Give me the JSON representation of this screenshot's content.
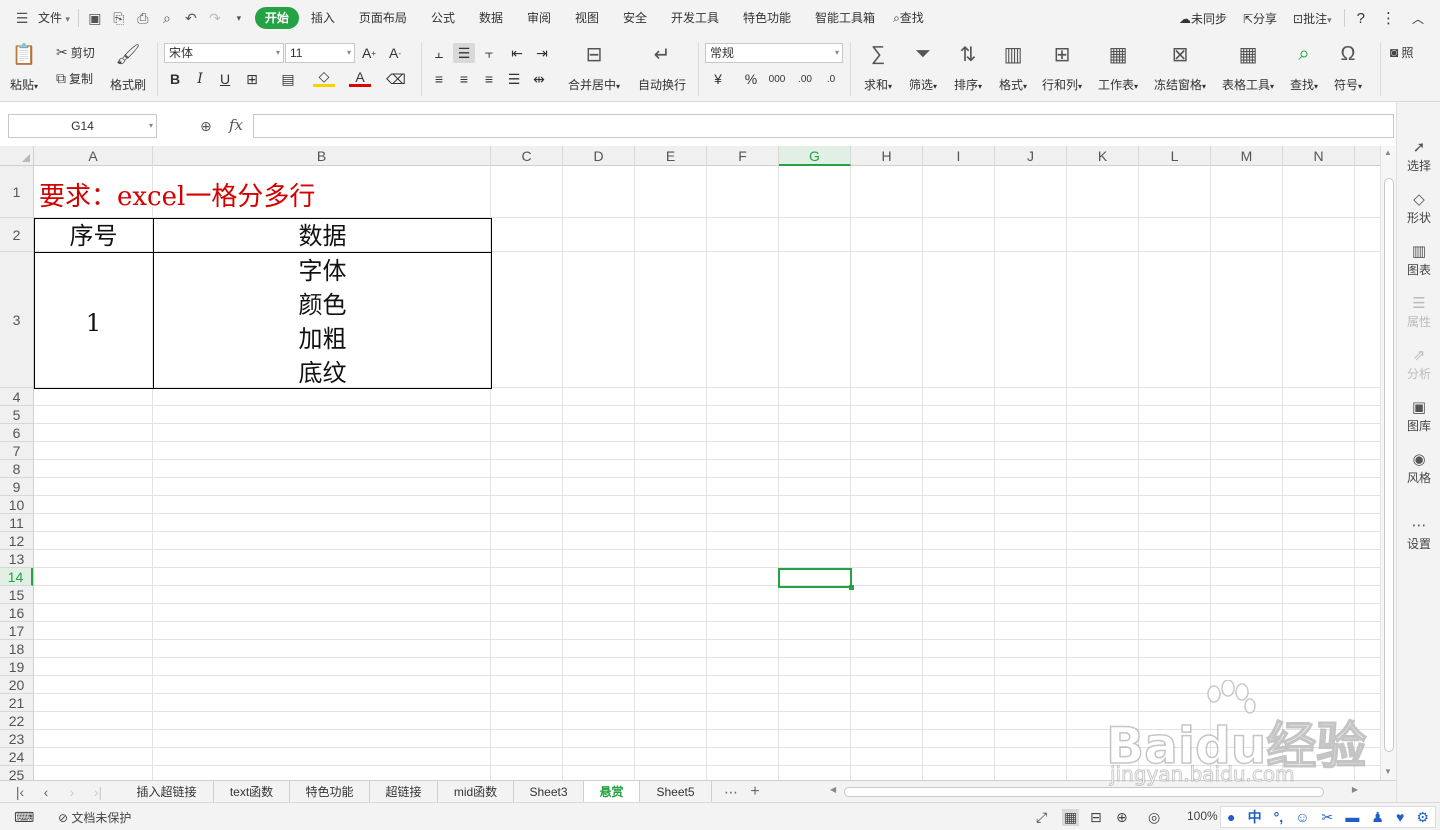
{
  "menubar": {
    "file_label": "文件",
    "tabs": [
      "开始",
      "插入",
      "页面布局",
      "公式",
      "数据",
      "审阅",
      "视图",
      "安全",
      "开发工具",
      "特色功能",
      "智能工具箱"
    ],
    "active_tab": "开始",
    "search_label": "查找",
    "sync_label": "未同步",
    "share_label": "分享",
    "comment_label": "批注"
  },
  "ribbon": {
    "paste_label": "粘贴",
    "cut_label": "剪切",
    "copy_label": "复制",
    "format_painter_label": "格式刷",
    "font_name": "宋体",
    "font_size": "11",
    "merge_label": "合并居中",
    "wrap_label": "自动换行",
    "number_format": "常规",
    "sum_label": "求和",
    "filter_label": "筛选",
    "sort_label": "排序",
    "format_label": "格式",
    "rowcol_label": "行和列",
    "sheet_label": "工作表",
    "freeze_label": "冻结窗格",
    "table_tools_label": "表格工具",
    "find_label": "查找",
    "symbol_label": "符号",
    "photo_label": "照"
  },
  "formula_bar": {
    "name_box": "G14",
    "fx_label": "fx",
    "formula": ""
  },
  "grid": {
    "columns": [
      "A",
      "B",
      "C",
      "D",
      "E",
      "F",
      "G",
      "H",
      "I",
      "J",
      "K",
      "L",
      "M",
      "N"
    ],
    "rows": [
      "1",
      "2",
      "3",
      "4",
      "5",
      "6",
      "7",
      "8",
      "9",
      "10",
      "11",
      "12",
      "13",
      "14",
      "15",
      "16",
      "17",
      "18",
      "19",
      "20",
      "21",
      "22",
      "23",
      "24",
      "25"
    ],
    "active_column": "G",
    "active_row": "14",
    "title": "要求：excel一格分多行",
    "header_seq": "序号",
    "header_data": "数据",
    "row3_seq": "1",
    "row3_data_lines": [
      "字体",
      "颜色",
      "加粗",
      "底纹"
    ]
  },
  "sidebar": {
    "items": [
      "选择",
      "形状",
      "图表",
      "属性",
      "分析",
      "图库",
      "风格",
      "设置"
    ]
  },
  "sheet_tabs": {
    "tabs": [
      "插入超链接",
      "text函数",
      "特色功能",
      "超链接",
      "mid函数",
      "Sheet3",
      "悬赏",
      "Sheet5"
    ],
    "active": "悬赏",
    "more": "⋯",
    "add": "+"
  },
  "status": {
    "protect_label": "文档未保护",
    "zoom": "100%",
    "ime_label": "中"
  },
  "watermark": {
    "brand": "Bai",
    "brand2": "du",
    "brand3": "经验",
    "url": "jingyan.baidu.com"
  },
  "colors": {
    "accent": "#25a244",
    "title_red": "#d40000"
  }
}
